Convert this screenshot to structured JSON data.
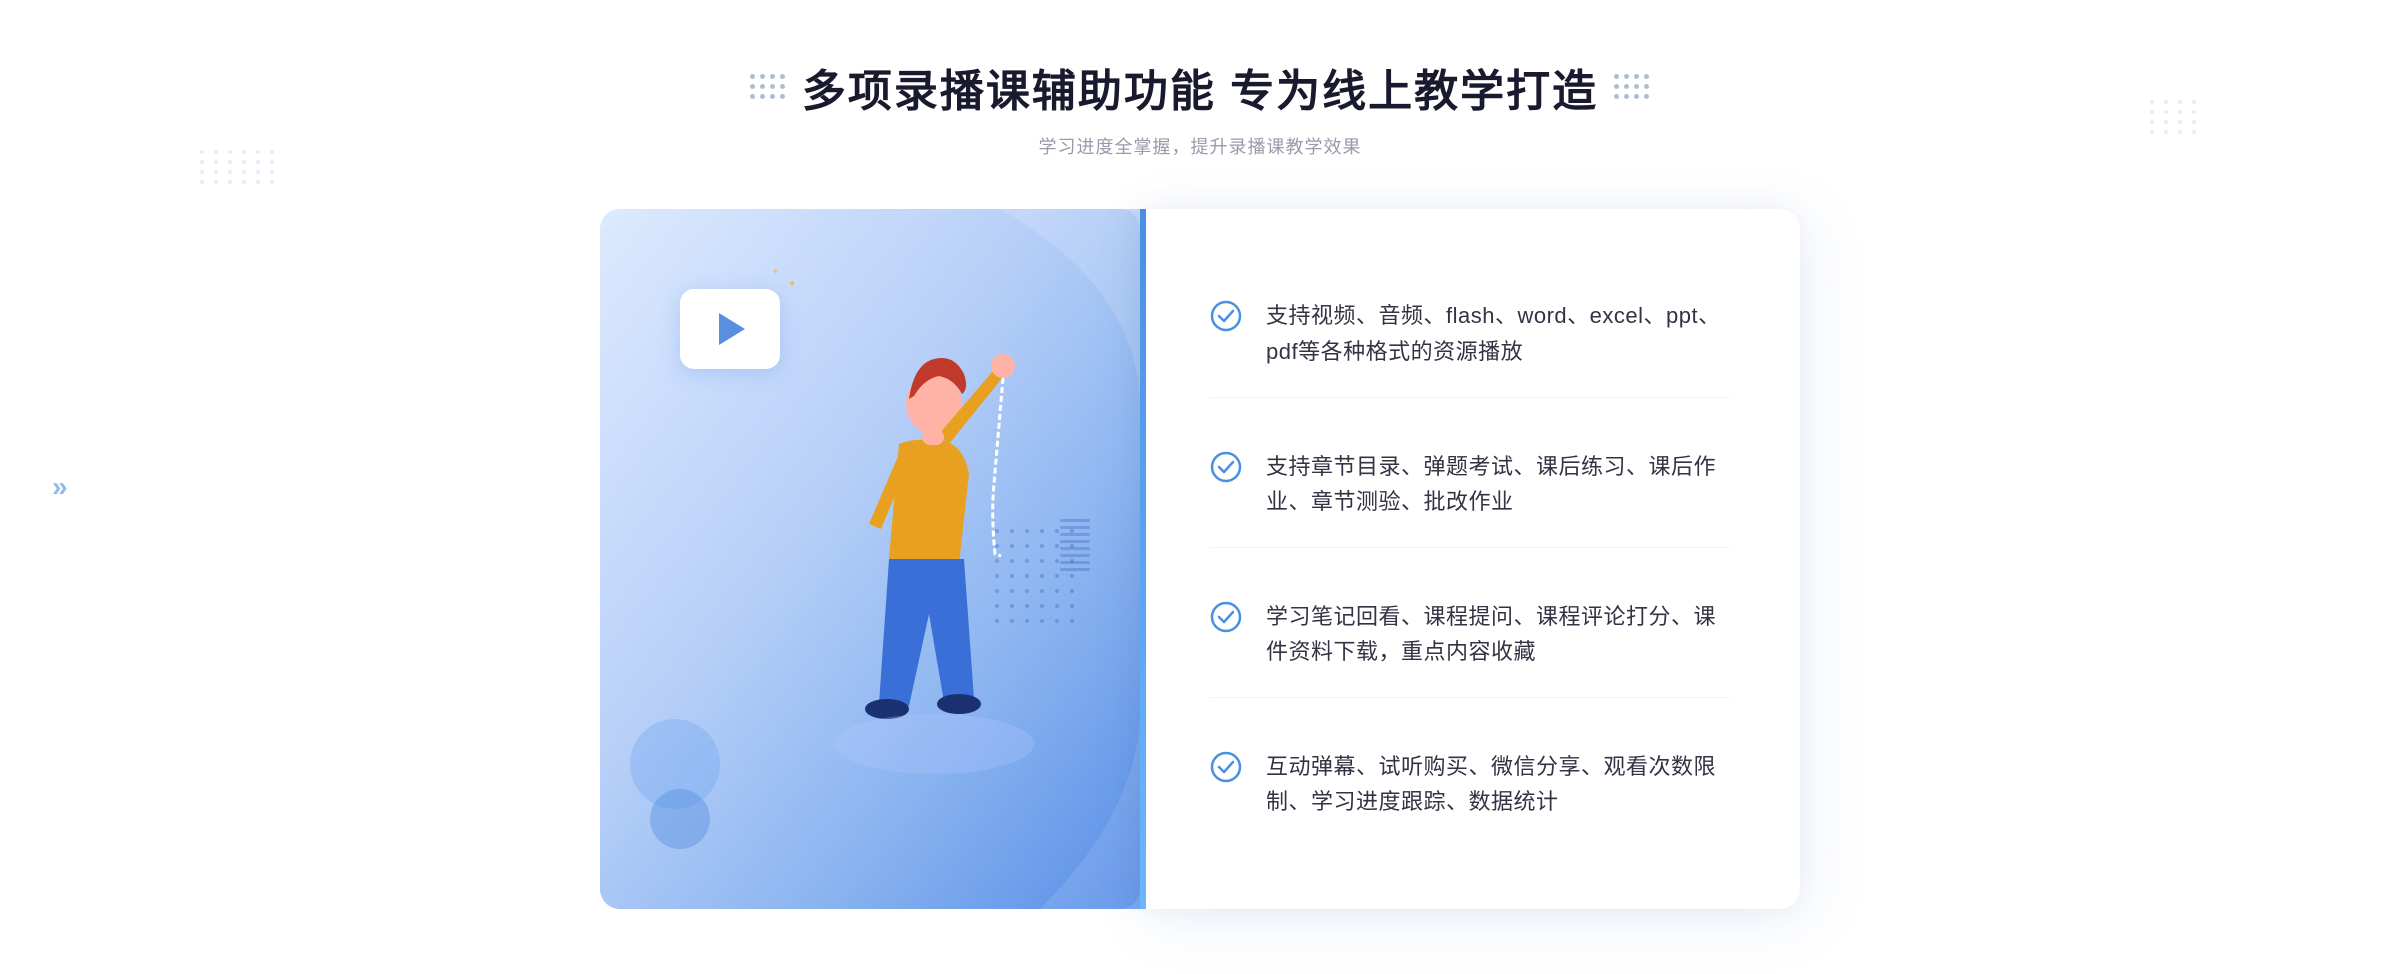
{
  "header": {
    "title": "多项录播课辅助功能 专为线上教学打造",
    "subtitle": "学习进度全掌握，提升录播课教学效果"
  },
  "features": [
    {
      "id": "feature-1",
      "text": "支持视频、音频、flash、word、excel、ppt、pdf等各种格式的资源播放"
    },
    {
      "id": "feature-2",
      "text": "支持章节目录、弹题考试、课后练习、课后作业、章节测验、批改作业"
    },
    {
      "id": "feature-3",
      "text": "学习笔记回看、课程提问、课程评论打分、课件资料下载，重点内容收藏"
    },
    {
      "id": "feature-4",
      "text": "互动弹幕、试听购买、微信分享、观看次数限制、学习进度跟踪、数据统计"
    }
  ],
  "illustration": {
    "play_icon": "▶",
    "chevrons": "»"
  }
}
